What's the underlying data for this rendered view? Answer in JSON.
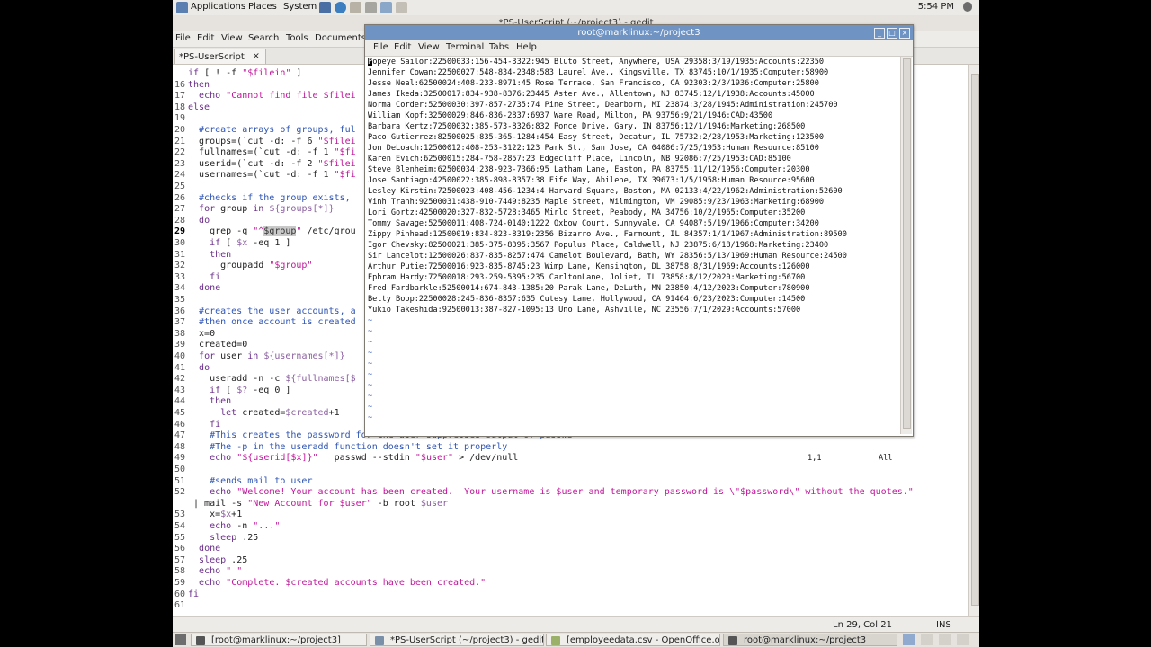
{
  "panel": {
    "applications": "Applications",
    "places": "Places",
    "system": "System",
    "time": "5:54 PM"
  },
  "gedit": {
    "title": "*PS-UserScript (~/project3) - gedit",
    "menu": [
      "File",
      "Edit",
      "View",
      "Search",
      "Tools",
      "Documents"
    ],
    "tab": "*PS-UserScript",
    "tab_close": "×",
    "lines": [
      {
        "n": "",
        "t": "if [ ! -f \"$filein\" ]"
      },
      {
        "n": "16",
        "t": "then"
      },
      {
        "n": "17",
        "t": "  echo \"Cannot find file $filei"
      },
      {
        "n": "18",
        "t": "else"
      },
      {
        "n": "19",
        "t": ""
      },
      {
        "n": "20",
        "t": "  #create arrays of groups, ful"
      },
      {
        "n": "21",
        "t": "  groups=(`cut -d: -f 6 \"$filei"
      },
      {
        "n": "22",
        "t": "  fullnames=(`cut -d: -f 1 \"$fi"
      },
      {
        "n": "23",
        "t": "  userid=(`cut -d: -f 2 \"$filei"
      },
      {
        "n": "24",
        "t": "  usernames=(`cut -d: -f 1 \"$fi"
      },
      {
        "n": "25",
        "t": ""
      },
      {
        "n": "26",
        "t": "  #checks if the group exists,"
      },
      {
        "n": "27",
        "t": "  for group in ${groups[*]}"
      },
      {
        "n": "28",
        "t": "  do"
      },
      {
        "n": "29",
        "t": "    grep -q \"^$group\" /etc/grou"
      },
      {
        "n": "30",
        "t": "    if [ $x -eq 1 ]"
      },
      {
        "n": "31",
        "t": "    then"
      },
      {
        "n": "32",
        "t": "      groupadd \"$group\""
      },
      {
        "n": "33",
        "t": "    fi"
      },
      {
        "n": "34",
        "t": "  done"
      },
      {
        "n": "35",
        "t": ""
      },
      {
        "n": "36",
        "t": "  #creates the user accounts, a"
      },
      {
        "n": "37",
        "t": "  #then once account is created"
      },
      {
        "n": "38",
        "t": "  x=0"
      },
      {
        "n": "39",
        "t": "  created=0"
      },
      {
        "n": "40",
        "t": "  for user in ${usernames[*]}"
      },
      {
        "n": "41",
        "t": "  do"
      },
      {
        "n": "42",
        "t": "    useradd -n -c ${fullnames[$"
      },
      {
        "n": "43",
        "t": "    if [ $? -eq 0 ]"
      },
      {
        "n": "44",
        "t": "    then"
      },
      {
        "n": "45",
        "t": "      let created=$created+1"
      },
      {
        "n": "46",
        "t": "    fi"
      },
      {
        "n": "47",
        "t": "    #This creates the password for the user suppresses output of passwd"
      },
      {
        "n": "48",
        "t": "    #The -p in the useradd function doesn't set it properly"
      },
      {
        "n": "49",
        "t": "    echo \"${userid[$x]}\" | passwd --stdin \"$user\" > /dev/null"
      },
      {
        "n": "50",
        "t": ""
      },
      {
        "n": "51",
        "t": "    #sends mail to user"
      },
      {
        "n": "52",
        "t": "    echo \"Welcome! Your account has been created.  Your username is $user and temporary password is \\\"$password\\\" without the quotes.\""
      },
      {
        "n": "",
        "t": " | mail -s \"New Account for $user\" -b root $user"
      },
      {
        "n": "53",
        "t": "    x=$x+1"
      },
      {
        "n": "54",
        "t": "    echo -n \"...\""
      },
      {
        "n": "55",
        "t": "    sleep .25"
      },
      {
        "n": "56",
        "t": "  done"
      },
      {
        "n": "57",
        "t": "  sleep .25"
      },
      {
        "n": "58",
        "t": "  echo \" \""
      },
      {
        "n": "59",
        "t": "  echo \"Complete. $created accounts have been created.\""
      },
      {
        "n": "60",
        "t": "fi"
      },
      {
        "n": "61",
        "t": ""
      }
    ],
    "status_pos": "Ln 29, Col 21",
    "status_mode": "INS"
  },
  "terminal": {
    "title": "root@marklinux:~/project3",
    "menu": [
      "File",
      "Edit",
      "View",
      "Terminal",
      "Tabs",
      "Help"
    ],
    "rows": [
      "Popeye Sailor:22500033:156-454-3322:945 Bluto Street, Anywhere, USA 29358:3/19/1935:Accounts:22350",
      "Jennifer Cowan:22500027:548-834-2348:583 Laurel Ave., Kingsville, TX 83745:10/1/1935:Computer:58900",
      "Jesse Neal:62500024:408-233-8971:45 Rose Terrace, San Francisco, CA 92303:2/3/1936:Computer:25800",
      "James Ikeda:32500017:834-938-8376:23445 Aster Ave., Allentown, NJ 83745:12/1/1938:Accounts:45000",
      "Norma Corder:52500030:397-857-2735:74 Pine Street, Dearborn, MI 23874:3/28/1945:Administration:245700",
      "William Kopf:32500029:846-836-2837:6937 Ware Road, Milton, PA 93756:9/21/1946:CAD:43500",
      "Barbara Kertz:72500032:385-573-8326:832 Ponce Drive, Gary, IN 83756:12/1/1946:Marketing:268500",
      "Paco Gutierrez:82500025:835-365-1284:454 Easy Street, Decatur, IL 75732:2/28/1953:Marketing:123500",
      "Jon DeLoach:12500012:408-253-3122:123 Park St., San Jose, CA 04086:7/25/1953:Human Resource:85100",
      "Karen Evich:62500015:284-758-2857:23 Edgecliff Place, Lincoln, NB 92086:7/25/1953:CAD:85100",
      "Steve Blenheim:62500034:238-923-7366:95 Latham Lane, Easton, PA 83755:11/12/1956:Computer:20300",
      "Jose Santiago:42500022:385-898-8357:38 Fife Way, Abilene, TX 39673:1/5/1958:Human Resource:95600",
      "Lesley Kirstin:72500023:408-456-1234:4 Harvard Square, Boston, MA 02133:4/22/1962:Administration:52600",
      "Vinh Tranh:92500031:438-910-7449:8235 Maple Street, Wilmington, VM 29085:9/23/1963:Marketing:68900",
      "Lori Gortz:42500020:327-832-5728:3465 Mirlo Street, Peabody, MA 34756:10/2/1965:Computer:35200",
      "Tommy Savage:52500011:408-724-0140:1222 Oxbow Court, Sunnyvale, CA 94087:5/19/1966:Computer:34200",
      "Zippy Pinhead:12500019:834-823-8319:2356 Bizarro Ave., Farmount, IL 84357:1/1/1967:Administration:89500",
      "Igor Chevsky:82500021:385-375-8395:3567 Populus Place, Caldwell, NJ 23875:6/18/1968:Marketing:23400",
      "Sir Lancelot:12500026:837-835-8257:474 Camelot Boulevard, Bath, WY 28356:5/13/1969:Human Resource:24500",
      "Arthur Putie:72500016:923-835-8745:23 Wimp Lane, Kensington, DL 38758:8/31/1969:Accounts:126000",
      "Ephram Hardy:72500018:293-259-5395:235 CarltonLane, Joliet, IL 73858:8/12/2020:Marketing:56700",
      "Fred Fardbarkle:52500014:674-843-1385:20 Parak Lane, DeLuth, MN 23850:4/12/2023:Computer:780900",
      "Betty Boop:22500028:245-836-8357:635 Cutesy Lane, Hollywood, CA 91464:6/23/2023:Computer:14500",
      "Yukio Takeshida:92500013:387-827-1095:13 Uno Lane, Ashville, NC 23556:7/1/2029:Accounts:57000"
    ],
    "tilde": "~",
    "pos": "1,1",
    "scroll": "All"
  },
  "taskbar": [
    "[root@marklinux:~/project3]",
    "*PS-UserScript (~/project3) - gedit",
    "[employeedata.csv - OpenOffice.or...",
    "root@marklinux:~/project3"
  ]
}
